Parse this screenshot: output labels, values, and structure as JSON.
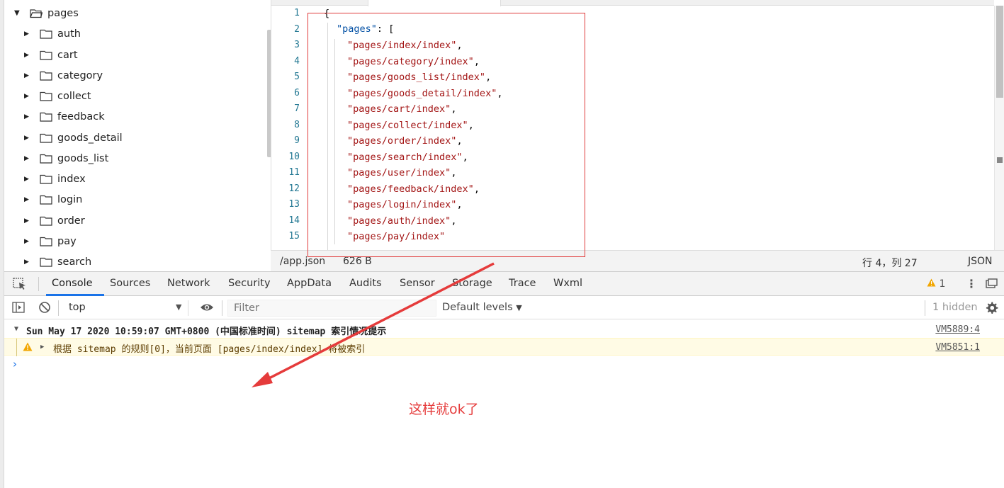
{
  "tree": {
    "root": "pages",
    "folders": [
      "auth",
      "cart",
      "category",
      "collect",
      "feedback",
      "goods_detail",
      "goods_list",
      "index",
      "login",
      "order",
      "pay",
      "search"
    ]
  },
  "editor": {
    "line_numbers": [
      "1",
      "2",
      "3",
      "4",
      "5",
      "6",
      "7",
      "8",
      "9",
      "10",
      "11",
      "12",
      "13",
      "14",
      "15"
    ],
    "code": {
      "open_brace": "{",
      "pages_key": "\"pages\"",
      "pages_open": ": [",
      "entries": [
        "\"pages/index/index\"",
        "\"pages/category/index\"",
        "\"pages/goods_list/index\"",
        "\"pages/goods_detail/index\"",
        "\"pages/cart/index\"",
        "\"pages/collect/index\"",
        "\"pages/order/index\"",
        "\"pages/search/index\"",
        "\"pages/user/index\"",
        "\"pages/feedback/index\"",
        "\"pages/login/index\"",
        "\"pages/auth/index\"",
        "\"pages/pay/index\""
      ],
      "separators": [
        ",",
        ",",
        ",",
        ",",
        ",",
        ",",
        ",",
        ",",
        ",",
        ",",
        ",",
        ",",
        ""
      ]
    }
  },
  "statusbar": {
    "file_path": "/app.json",
    "file_size": "626 B",
    "cursor": "行 4，列 27",
    "language": "JSON"
  },
  "devtools": {
    "tabs": [
      "Console",
      "Sources",
      "Network",
      "Security",
      "AppData",
      "Audits",
      "Sensor",
      "Storage",
      "Trace",
      "Wxml"
    ],
    "warning_count": "1"
  },
  "console_toolbar": {
    "context": "top",
    "filter_placeholder": "Filter",
    "levels": "Default levels",
    "hidden": "1 hidden"
  },
  "console": {
    "group_title": "Sun May 17 2020 10:59:07 GMT+0800 (中国标准时间) sitemap 索引情况提示",
    "group_source": "VM5889:4",
    "warning_text": "根据 sitemap 的规则[0]，当前页面 [pages/index/index] 将被索引",
    "warning_source": "VM5851:1",
    "prompt": "›"
  },
  "annotation": {
    "text": "这样就ok了",
    "color": "#e53b3b"
  }
}
